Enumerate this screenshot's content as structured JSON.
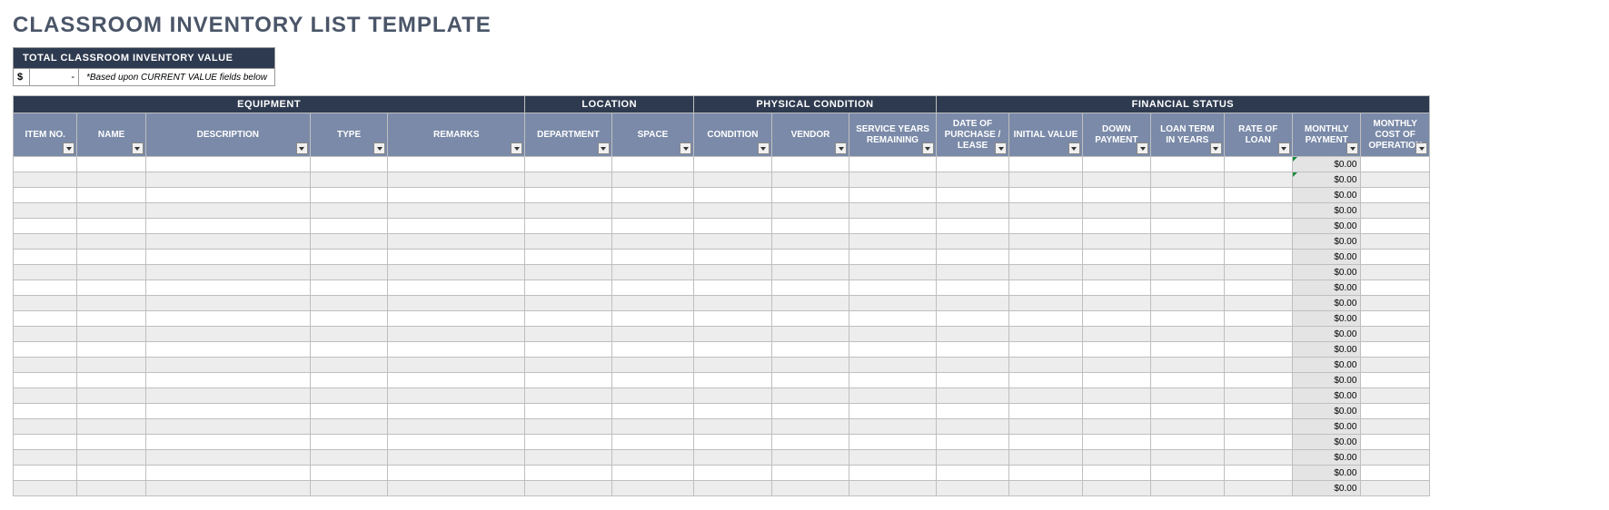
{
  "title": "CLASSROOM INVENTORY LIST TEMPLATE",
  "total_box": {
    "header": "TOTAL CLASSROOM INVENTORY VALUE",
    "currency": "$",
    "value": "-",
    "note": "*Based upon CURRENT VALUE fields below"
  },
  "groups": [
    {
      "label": "EQUIPMENT",
      "span": 5
    },
    {
      "label": "LOCATION",
      "span": 2
    },
    {
      "label": "PHYSICAL CONDITION",
      "span": 3
    },
    {
      "label": "FINANCIAL STATUS",
      "span": 7
    }
  ],
  "columns": [
    "ITEM NO.",
    "NAME",
    "DESCRIPTION",
    "TYPE",
    "REMARKS",
    "DEPARTMENT",
    "SPACE",
    "CONDITION",
    "VENDOR",
    "SERVICE YEARS REMAINING",
    "DATE OF PURCHASE / LEASE",
    "INITIAL VALUE",
    "DOWN PAYMENT",
    "LOAN TERM IN YEARS",
    "RATE OF LOAN",
    "MONTHLY PAYMENT",
    "MONTHLY COST OF OPERATION"
  ],
  "chart_data": {
    "type": "table",
    "row_count": 22,
    "monthly_payment_default": "$0.00",
    "rows": []
  }
}
